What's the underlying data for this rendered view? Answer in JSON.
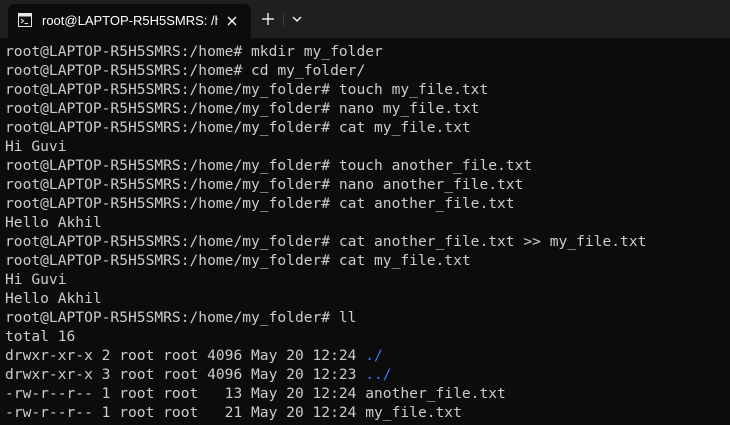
{
  "tab": {
    "title": "root@LAPTOP-R5H5SMRS: /h",
    "icon": "terminal-icon",
    "close_icon": "close-icon"
  },
  "tabbar": {
    "new_tab_icon": "plus-icon",
    "dropdown_icon": "chevron-down-icon"
  },
  "colors": {
    "background": "#0c0c0c",
    "tabbar": "#1f1f1f",
    "text": "#cccccc",
    "directory": "#3b78ff"
  },
  "terminal": {
    "lines": [
      {
        "text": "root@LAPTOP-R5H5SMRS:/home# mkdir my_folder"
      },
      {
        "text": "root@LAPTOP-R5H5SMRS:/home# cd my_folder/"
      },
      {
        "text": "root@LAPTOP-R5H5SMRS:/home/my_folder# touch my_file.txt"
      },
      {
        "text": "root@LAPTOP-R5H5SMRS:/home/my_folder# nano my_file.txt"
      },
      {
        "text": "root@LAPTOP-R5H5SMRS:/home/my_folder# cat my_file.txt"
      },
      {
        "text": "Hi Guvi"
      },
      {
        "text": "root@LAPTOP-R5H5SMRS:/home/my_folder# touch another_file.txt"
      },
      {
        "text": "root@LAPTOP-R5H5SMRS:/home/my_folder# nano another_file.txt"
      },
      {
        "text": "root@LAPTOP-R5H5SMRS:/home/my_folder# cat another_file.txt"
      },
      {
        "text": "Hello Akhil"
      },
      {
        "text": "root@LAPTOP-R5H5SMRS:/home/my_folder# cat another_file.txt >> my_file.txt"
      },
      {
        "text": "root@LAPTOP-R5H5SMRS:/home/my_folder# cat my_file.txt"
      },
      {
        "text": "Hi Guvi"
      },
      {
        "text": "Hello Akhil"
      },
      {
        "text": "root@LAPTOP-R5H5SMRS:/home/my_folder# ll"
      },
      {
        "text": "total 16"
      },
      {
        "text": "drwxr-xr-x 2 root root 4096 May 20 12:24 ",
        "dir": "./"
      },
      {
        "text": "drwxr-xr-x 3 root root 4096 May 20 12:23 ",
        "dir": "../"
      },
      {
        "text": "-rw-r--r-- 1 root root   13 May 20 12:24 another_file.txt"
      },
      {
        "text": "-rw-r--r-- 1 root root   21 May 20 12:24 my_file.txt"
      }
    ]
  }
}
